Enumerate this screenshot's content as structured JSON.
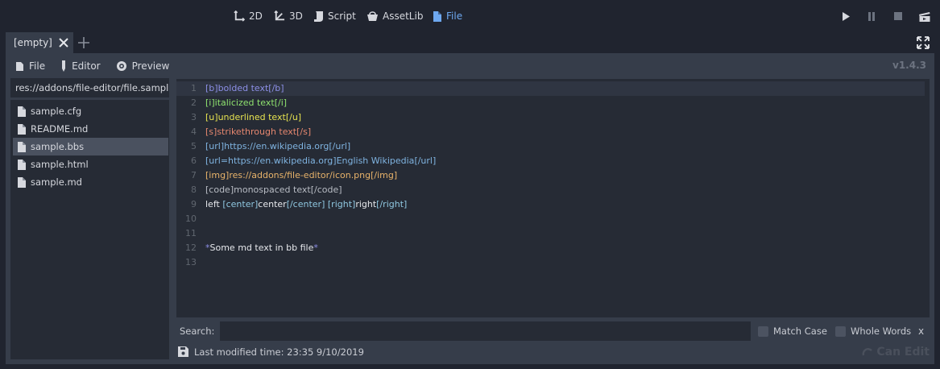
{
  "main_screens": [
    {
      "label": "2D",
      "icon": "2d-icon"
    },
    {
      "label": "3D",
      "icon": "3d-icon"
    },
    {
      "label": "Script",
      "icon": "script-icon"
    },
    {
      "label": "AssetLib",
      "icon": "assetlib-icon"
    },
    {
      "label": "File",
      "icon": "file-icon",
      "active": true
    }
  ],
  "tabs": [
    {
      "label": "[empty]"
    }
  ],
  "toolbar": {
    "file_label": "File",
    "editor_label": "Editor",
    "preview_label": "Preview",
    "version": "v1.4.3"
  },
  "sidebar": {
    "path": "res://addons/file-editor/file.sampl",
    "files": [
      "sample.cfg",
      "README.md",
      "sample.bbs",
      "sample.html",
      "sample.md"
    ],
    "selected_index": 2
  },
  "editor": {
    "current_line": 1,
    "lines": [
      {
        "n": "1",
        "segments": [
          {
            "t": "[b]",
            "c": "#8c8fe6"
          },
          {
            "t": "bolded text",
            "c": "#8c8fe6"
          },
          {
            "t": "[/b]",
            "c": "#8c8fe6"
          }
        ]
      },
      {
        "n": "2",
        "segments": [
          {
            "t": "[i]",
            "c": "#8fe36f"
          },
          {
            "t": "italicized text",
            "c": "#8fe36f"
          },
          {
            "t": "[/i]",
            "c": "#8fe36f"
          }
        ]
      },
      {
        "n": "3",
        "segments": [
          {
            "t": "[u]",
            "c": "#e6e34f"
          },
          {
            "t": "underlined text",
            "c": "#e6e34f"
          },
          {
            "t": "[/u]",
            "c": "#e6e34f"
          }
        ]
      },
      {
        "n": "4",
        "segments": [
          {
            "t": "[s]",
            "c": "#e6876f"
          },
          {
            "t": "strikethrough text",
            "c": "#e6876f"
          },
          {
            "t": "[/s]",
            "c": "#e6876f"
          }
        ]
      },
      {
        "n": "5",
        "segments": [
          {
            "t": "[url]",
            "c": "#7fb3e0"
          },
          {
            "t": "https://en.wikipedia.org",
            "c": "#7fb3e0"
          },
          {
            "t": "[/url]",
            "c": "#7fb3e0"
          }
        ]
      },
      {
        "n": "6",
        "segments": [
          {
            "t": "[url=https://en.wikipedia.org]",
            "c": "#7fb3e0"
          },
          {
            "t": "English Wikipedia",
            "c": "#7fb3e0"
          },
          {
            "t": "[/url]",
            "c": "#7fb3e0"
          }
        ]
      },
      {
        "n": "7",
        "segments": [
          {
            "t": "[img]",
            "c": "#e8b36a"
          },
          {
            "t": "res://addons/file-editor/icon.png",
            "c": "#e8b36a"
          },
          {
            "t": "[/img]",
            "c": "#e8b36a"
          }
        ]
      },
      {
        "n": "8",
        "segments": [
          {
            "t": "[code]",
            "c": "#b8bcc4"
          },
          {
            "t": "monospaced text",
            "c": "#b8bcc4"
          },
          {
            "t": "[/code]",
            "c": "#b8bcc4"
          }
        ]
      },
      {
        "n": "9",
        "segments": [
          {
            "t": "left ",
            "c": "#e6e8ec"
          },
          {
            "t": "[center]",
            "c": "#8fc7e0"
          },
          {
            "t": "center",
            "c": "#e6e8ec"
          },
          {
            "t": "[/center] ",
            "c": "#8fc7e0"
          },
          {
            "t": "[right]",
            "c": "#8fc7e0"
          },
          {
            "t": "right",
            "c": "#e6e8ec"
          },
          {
            "t": "[/right]",
            "c": "#8fc7e0"
          }
        ]
      },
      {
        "n": "10",
        "segments": []
      },
      {
        "n": "11",
        "segments": []
      },
      {
        "n": "12",
        "segments": [
          {
            "t": "*",
            "c": "#8c8fe6"
          },
          {
            "t": "Some md text in bb file",
            "c": "#e6e8ec"
          },
          {
            "t": "*",
            "c": "#8c8fe6"
          }
        ]
      },
      {
        "n": "13",
        "segments": []
      }
    ]
  },
  "search": {
    "label": "Search:",
    "value": "",
    "match_case_label": "Match Case",
    "whole_words_label": "Whole Words",
    "close_label": "x"
  },
  "status": {
    "text": "Last modified time:   23:35  9/10/2019",
    "can_edit_label": "Can Edit"
  },
  "colors": {
    "background": "#20242f",
    "panel": "#363d4a",
    "field": "#262b35",
    "accent": "#6ea8f0"
  }
}
